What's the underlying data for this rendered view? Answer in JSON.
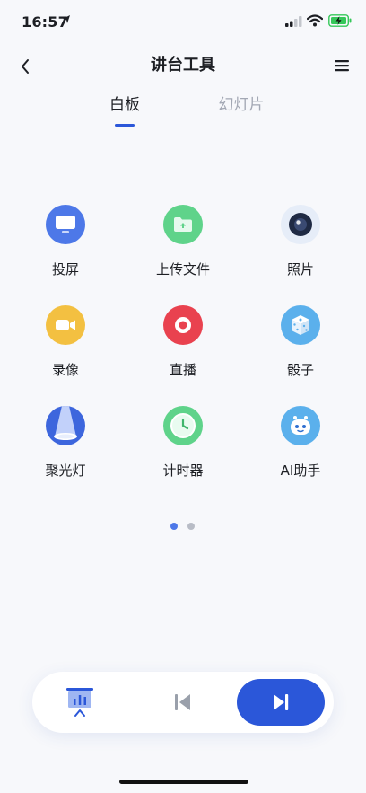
{
  "status": {
    "time": "16:57"
  },
  "nav": {
    "title": "讲台工具"
  },
  "tabs": [
    {
      "label": "白板",
      "active": true
    },
    {
      "label": "幻灯片",
      "active": false
    }
  ],
  "tools": [
    {
      "label": "投屏",
      "icon": "monitor-icon",
      "color": "#4d78e8"
    },
    {
      "label": "上传文件",
      "icon": "upload-folder-icon",
      "color": "#5fd38a"
    },
    {
      "label": "照片",
      "icon": "camera-lens-icon",
      "color": "#e6edf8"
    },
    {
      "label": "录像",
      "icon": "video-camera-icon",
      "color": "#f3c041"
    },
    {
      "label": "直播",
      "icon": "live-record-icon",
      "color": "#e9424f"
    },
    {
      "label": "骰子",
      "icon": "dice-icon",
      "color": "#5bb0ec"
    },
    {
      "label": "聚光灯",
      "icon": "spotlight-icon",
      "color": "#3d66dd"
    },
    {
      "label": "计时器",
      "icon": "timer-icon",
      "color": "#5fd38a"
    },
    {
      "label": "AI助手",
      "icon": "robot-icon",
      "color": "#5bb0ec"
    }
  ],
  "pagination": {
    "current": 1,
    "total": 2,
    "active_color": "#4d78e8",
    "inactive_color": "#b8bcc6"
  },
  "controls": {
    "accent": "#2b57d9"
  }
}
